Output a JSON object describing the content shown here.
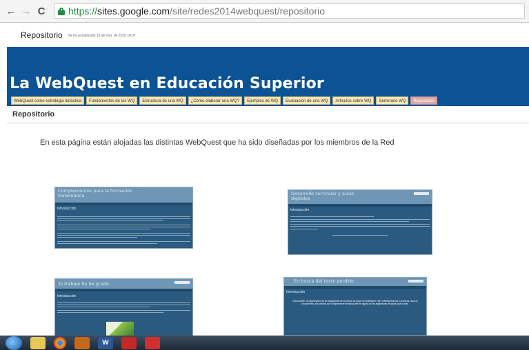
{
  "browser": {
    "url_scheme": "https://",
    "url_host": "sites.google.com",
    "url_path": "/site/redes2014webquest/repositorio",
    "back_icon": "←",
    "forward_icon": "→",
    "reload_icon": "C"
  },
  "site": {
    "page_name": "Repositorio",
    "updated_text": "Se ha actualizado 19 de mar. de 2016 10:37",
    "title": "La WebQuest en Educación Superior",
    "tabs": [
      "WebQuest como estrategia didáctica",
      "Fundamentos de las WQ",
      "Estructura de una WQ",
      "¿Cómo elaborar una WQ?",
      "Ejemplos de WQ",
      "Evaluación de una WQ",
      "Artículos sobre WQ",
      "Seminario WQ",
      "Repositorio"
    ],
    "active_tab_index": 8
  },
  "content": {
    "heading": "Repositorio",
    "intro": "En esta página están alojadas las distintas WebQuest que ha sido diseñadas por los miembros de la Red",
    "thumbnails": [
      {
        "title": "Complementos para la formación Matemática",
        "section": "Introducción"
      },
      {
        "title": "Desarrollo curricular y aulas digitales",
        "section": "Introducción"
      },
      {
        "title": "Tu trabajo fin de grado",
        "section": "Introducción"
      },
      {
        "title": "En busca del texto perdido",
        "section": "Introducción"
      }
    ],
    "thumb4_body": "Como saben, la organización de las asignaturas de los títulos de grado se distribuyen entre créditos teóricos y prácticos. Aquí os proponemos una práctica que complemente formará parte de alguna de las asignaturas del grado que cursas."
  },
  "taskbar": {
    "word_label": "W",
    "colors": {
      "accent": "#0b5394",
      "tab_bg": "#f6e7b6",
      "active_tab": "#d9a8a8"
    }
  }
}
